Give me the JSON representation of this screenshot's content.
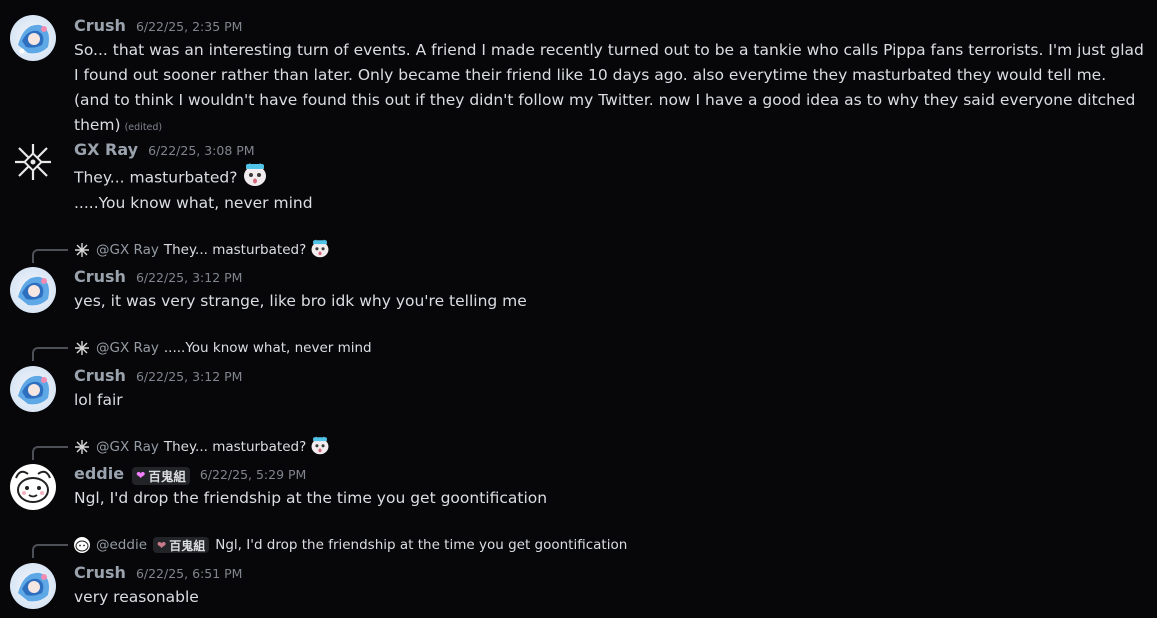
{
  "messages": [
    {
      "username": "Crush",
      "timestamp": "6/22/25, 2:35 PM",
      "avatar_icon": "crush-avatar-icon",
      "lines": [
        "So... that was an interesting turn of events. A friend I made recently turned out to be a tankie who calls Pippa fans terrorists. I'm just glad I found out sooner rather than later. Only became their friend like 10 days ago. also everytime they masturbated they would tell me. (and to think I wouldn't have found this out if they didn't follow my Twitter. now I have a good idea as to why they said everyone ditched them)"
      ],
      "edited_label": "(edited)"
    },
    {
      "username": "GX Ray",
      "timestamp": "6/22/25, 3:08 PM",
      "avatar_icon": "gxray-avatar-icon",
      "line1": "They... masturbated?",
      "line2": ".....You know what, never mind"
    },
    {
      "reply_mention": "@GX Ray",
      "reply_text": "They... masturbated?",
      "username": "Crush",
      "timestamp": "6/22/25, 3:12 PM",
      "text": "yes, it was very strange, like bro idk why you're telling me"
    },
    {
      "reply_mention": "@GX Ray",
      "reply_text": ".....You know what, never mind",
      "username": "Crush",
      "timestamp": "6/22/25, 3:12 PM",
      "text": "lol fair"
    },
    {
      "reply_mention": "@GX Ray",
      "reply_text": "They... masturbated?",
      "username": "eddie",
      "tag": "百鬼組",
      "timestamp": "6/22/25, 5:29 PM",
      "text": "Ngl, I'd drop the friendship at the time you get goontification"
    },
    {
      "reply_mention": "@eddie",
      "reply_tag": "百鬼組",
      "reply_text": "Ngl, I'd drop the friendship at the time you get goontification",
      "username": "Crush",
      "timestamp": "6/22/25, 6:51 PM",
      "text": "very reasonable"
    }
  ],
  "colors": {
    "background": "#070709",
    "username": "#9aa3ad",
    "timestamp": "#80848e",
    "text": "#dbdee1"
  }
}
